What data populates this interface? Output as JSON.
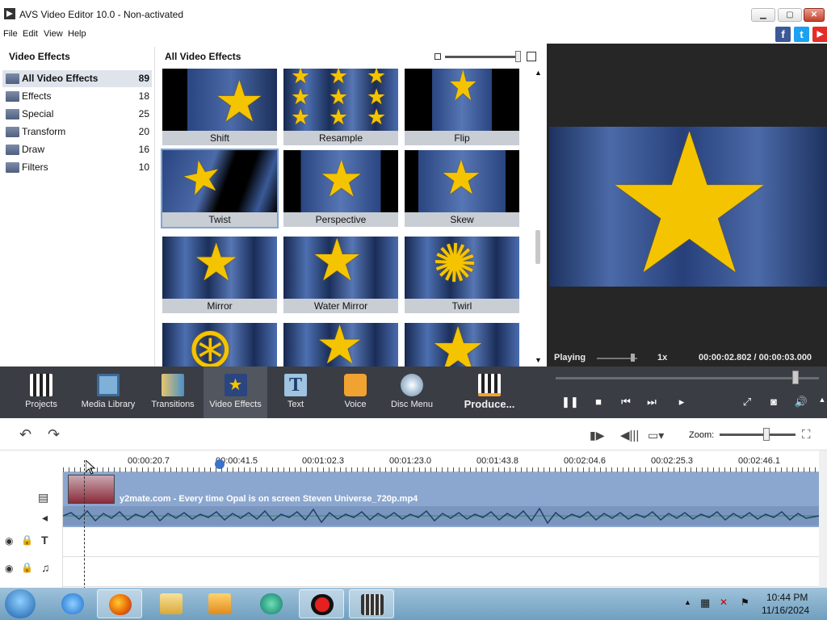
{
  "window": {
    "title": "AVS Video Editor 10.0 - Non-activated"
  },
  "menu": [
    "File",
    "Edit",
    "View",
    "Help"
  ],
  "social": [
    {
      "name": "facebook-icon",
      "glyph": "f",
      "color": "#3b5998"
    },
    {
      "name": "twitter-icon",
      "glyph": "t",
      "color": "#1da1f2"
    },
    {
      "name": "youtube-icon",
      "glyph": "▶",
      "color": "#e52d27"
    }
  ],
  "left_panel": {
    "title": "Video Effects",
    "categories": [
      {
        "label": "All Video Effects",
        "count": "89",
        "selected": true
      },
      {
        "label": "Effects",
        "count": "18"
      },
      {
        "label": "Special",
        "count": "25"
      },
      {
        "label": "Transform",
        "count": "20"
      },
      {
        "label": "Draw",
        "count": "16"
      },
      {
        "label": "Filters",
        "count": "10"
      }
    ]
  },
  "center_panel": {
    "title": "All Video Effects",
    "effects": [
      "Shift",
      "Resample",
      "Flip",
      "Twist",
      "Perspective",
      "Skew",
      "Mirror",
      "Water Mirror",
      "Twirl",
      "",
      "",
      ""
    ],
    "selected_effect": "Twist"
  },
  "preview": {
    "status": "Playing",
    "speed": "1x",
    "time": "00:00:02.802 / 00:00:03.000"
  },
  "toolbar": {
    "tools": [
      {
        "label": "Projects",
        "icon": "projects-icon",
        "color": "#d8d8d8"
      },
      {
        "label": "Media Library",
        "icon": "media-library-icon",
        "color": "#7fb0d8"
      },
      {
        "label": "Transitions",
        "icon": "transitions-icon",
        "color": "#e8c66a"
      },
      {
        "label": "Video Effects",
        "icon": "video-effects-icon",
        "color": "#4b6aa8",
        "selected": true
      },
      {
        "label": "Text",
        "icon": "text-icon",
        "color": "#9fc3e0"
      },
      {
        "label": "Voice",
        "icon": "voice-icon",
        "color": "#f0a330"
      },
      {
        "label": "Disc Menu",
        "icon": "disc-menu-icon",
        "color": "#bcd0e2"
      },
      {
        "label": "Produce...",
        "icon": "produce-icon",
        "color": "#e6e6e6"
      }
    ]
  },
  "timeline": {
    "zoom_label": "Zoom:",
    "ruler_ticks": [
      "00:00:20.7",
      "00:00:41.5",
      "00:01:02.3",
      "00:01:23.0",
      "00:01:43.8",
      "00:02:04.6",
      "00:02:25.3",
      "00:02:46.1"
    ],
    "clip_name": "y2mate.com - Every time Opal is on screen Steven Universe_720p.mp4"
  },
  "taskbar": {
    "time": "10:44 PM",
    "date": "11/16/2024"
  }
}
